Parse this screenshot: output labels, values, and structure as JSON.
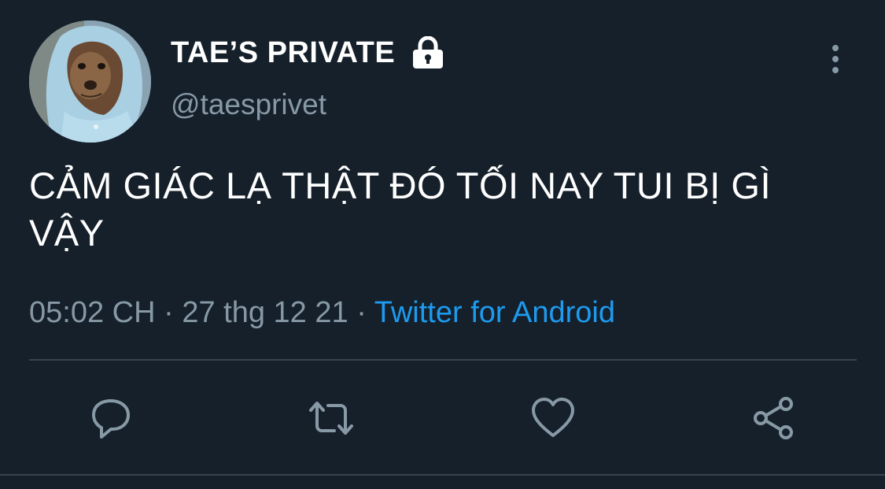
{
  "user": {
    "display_name": "TAE’S PRIVATE",
    "handle": "@taesprivet",
    "avatar_icon": "dog-in-hoodie-avatar",
    "protected_icon": "lock-icon"
  },
  "tweet": {
    "text": "CẢM GIÁC LẠ THẬT ĐÓ TỐI NAY TUI BỊ GÌ VẬY",
    "time": "05:02 CH",
    "separator": "·",
    "date": "27 thg 12 21",
    "source": "Twitter for Android"
  },
  "actions": {
    "reply_icon": "reply-icon",
    "retweet_icon": "retweet-icon",
    "like_icon": "heart-icon",
    "share_icon": "share-icon"
  },
  "colors": {
    "background": "#15202b",
    "primary_text": "#ffffff",
    "secondary_text": "#8899a6",
    "accent": "#1d9bf0",
    "divider": "#38444d"
  }
}
